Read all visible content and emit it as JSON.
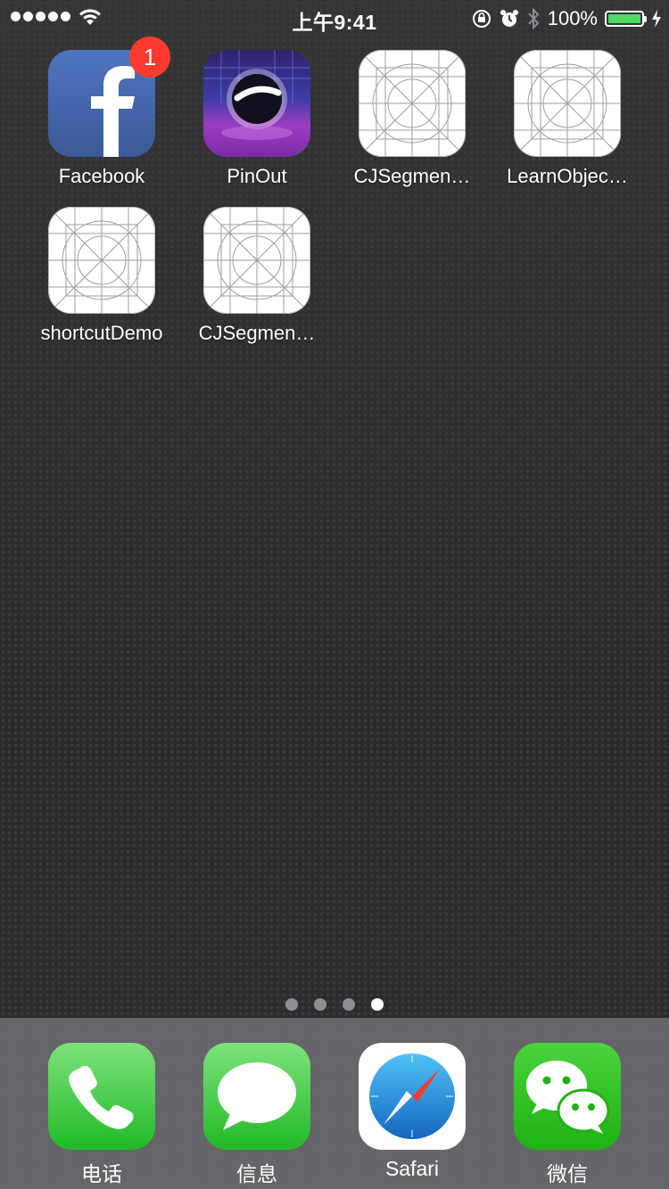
{
  "status_bar": {
    "time": "上午9:41",
    "battery_pct": "100%",
    "battery_level": 1.0,
    "signal_dots": 5,
    "icons": [
      "signal-icon",
      "wifi-icon",
      "rotation-lock-icon",
      "alarm-icon",
      "bluetooth-icon",
      "battery-icon",
      "charging-icon"
    ]
  },
  "apps": [
    {
      "label": "Facebook",
      "icon": "facebook-icon",
      "badge": "1"
    },
    {
      "label": "PinOut",
      "icon": "pinout-icon"
    },
    {
      "label": "CJSegmen…",
      "icon": "placeholder-app-icon"
    },
    {
      "label": "LearnObjec…",
      "icon": "placeholder-app-icon"
    },
    {
      "label": "shortcutDemo",
      "icon": "placeholder-app-icon"
    },
    {
      "label": "CJSegmen…",
      "icon": "placeholder-app-icon"
    }
  ],
  "page_indicator": {
    "count": 4,
    "current": 4
  },
  "dock": [
    {
      "label": "电话",
      "icon": "phone-icon"
    },
    {
      "label": "信息",
      "icon": "messages-icon"
    },
    {
      "label": "Safari",
      "icon": "safari-icon"
    },
    {
      "label": "微信",
      "icon": "wechat-icon"
    }
  ],
  "colors": {
    "badge": "#ff3b30",
    "battery": "#4cd964",
    "dock_green": "#22b928",
    "facebook_blue": "#3b5998"
  }
}
